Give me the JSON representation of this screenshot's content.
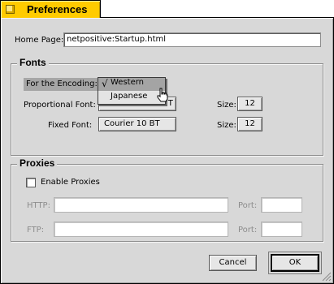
{
  "window": {
    "title": "Preferences"
  },
  "home_page": {
    "label": "Home Page:",
    "value": "netpositive:Startup.html"
  },
  "fonts": {
    "title": "Fonts",
    "encoding_label": "For the Encoding:",
    "encoding_menu": {
      "items": [
        {
          "label": "Western",
          "selected": true
        },
        {
          "label": "Japanese",
          "selected": false
        }
      ],
      "checkmark": "√"
    },
    "proportional": {
      "label": "Proportional Font:",
      "value": "Dutch801 Rm BT",
      "size_label": "Size:",
      "size": "12"
    },
    "fixed": {
      "label": "Fixed Font:",
      "value": "Courier 10 BT",
      "size_label": "Size:",
      "size": "12"
    }
  },
  "proxies": {
    "title": "Proxies",
    "enable_label": "Enable Proxies",
    "enabled": false,
    "http_label": "HTTP:",
    "ftp_label": "FTP:",
    "port_label": "Port:",
    "http_value": "",
    "http_port": "",
    "ftp_value": "",
    "ftp_port": ""
  },
  "buttons": {
    "cancel": "Cancel",
    "ok": "OK"
  },
  "colors": {
    "tab": "#ffcb00",
    "window": "#d8d8d8"
  }
}
